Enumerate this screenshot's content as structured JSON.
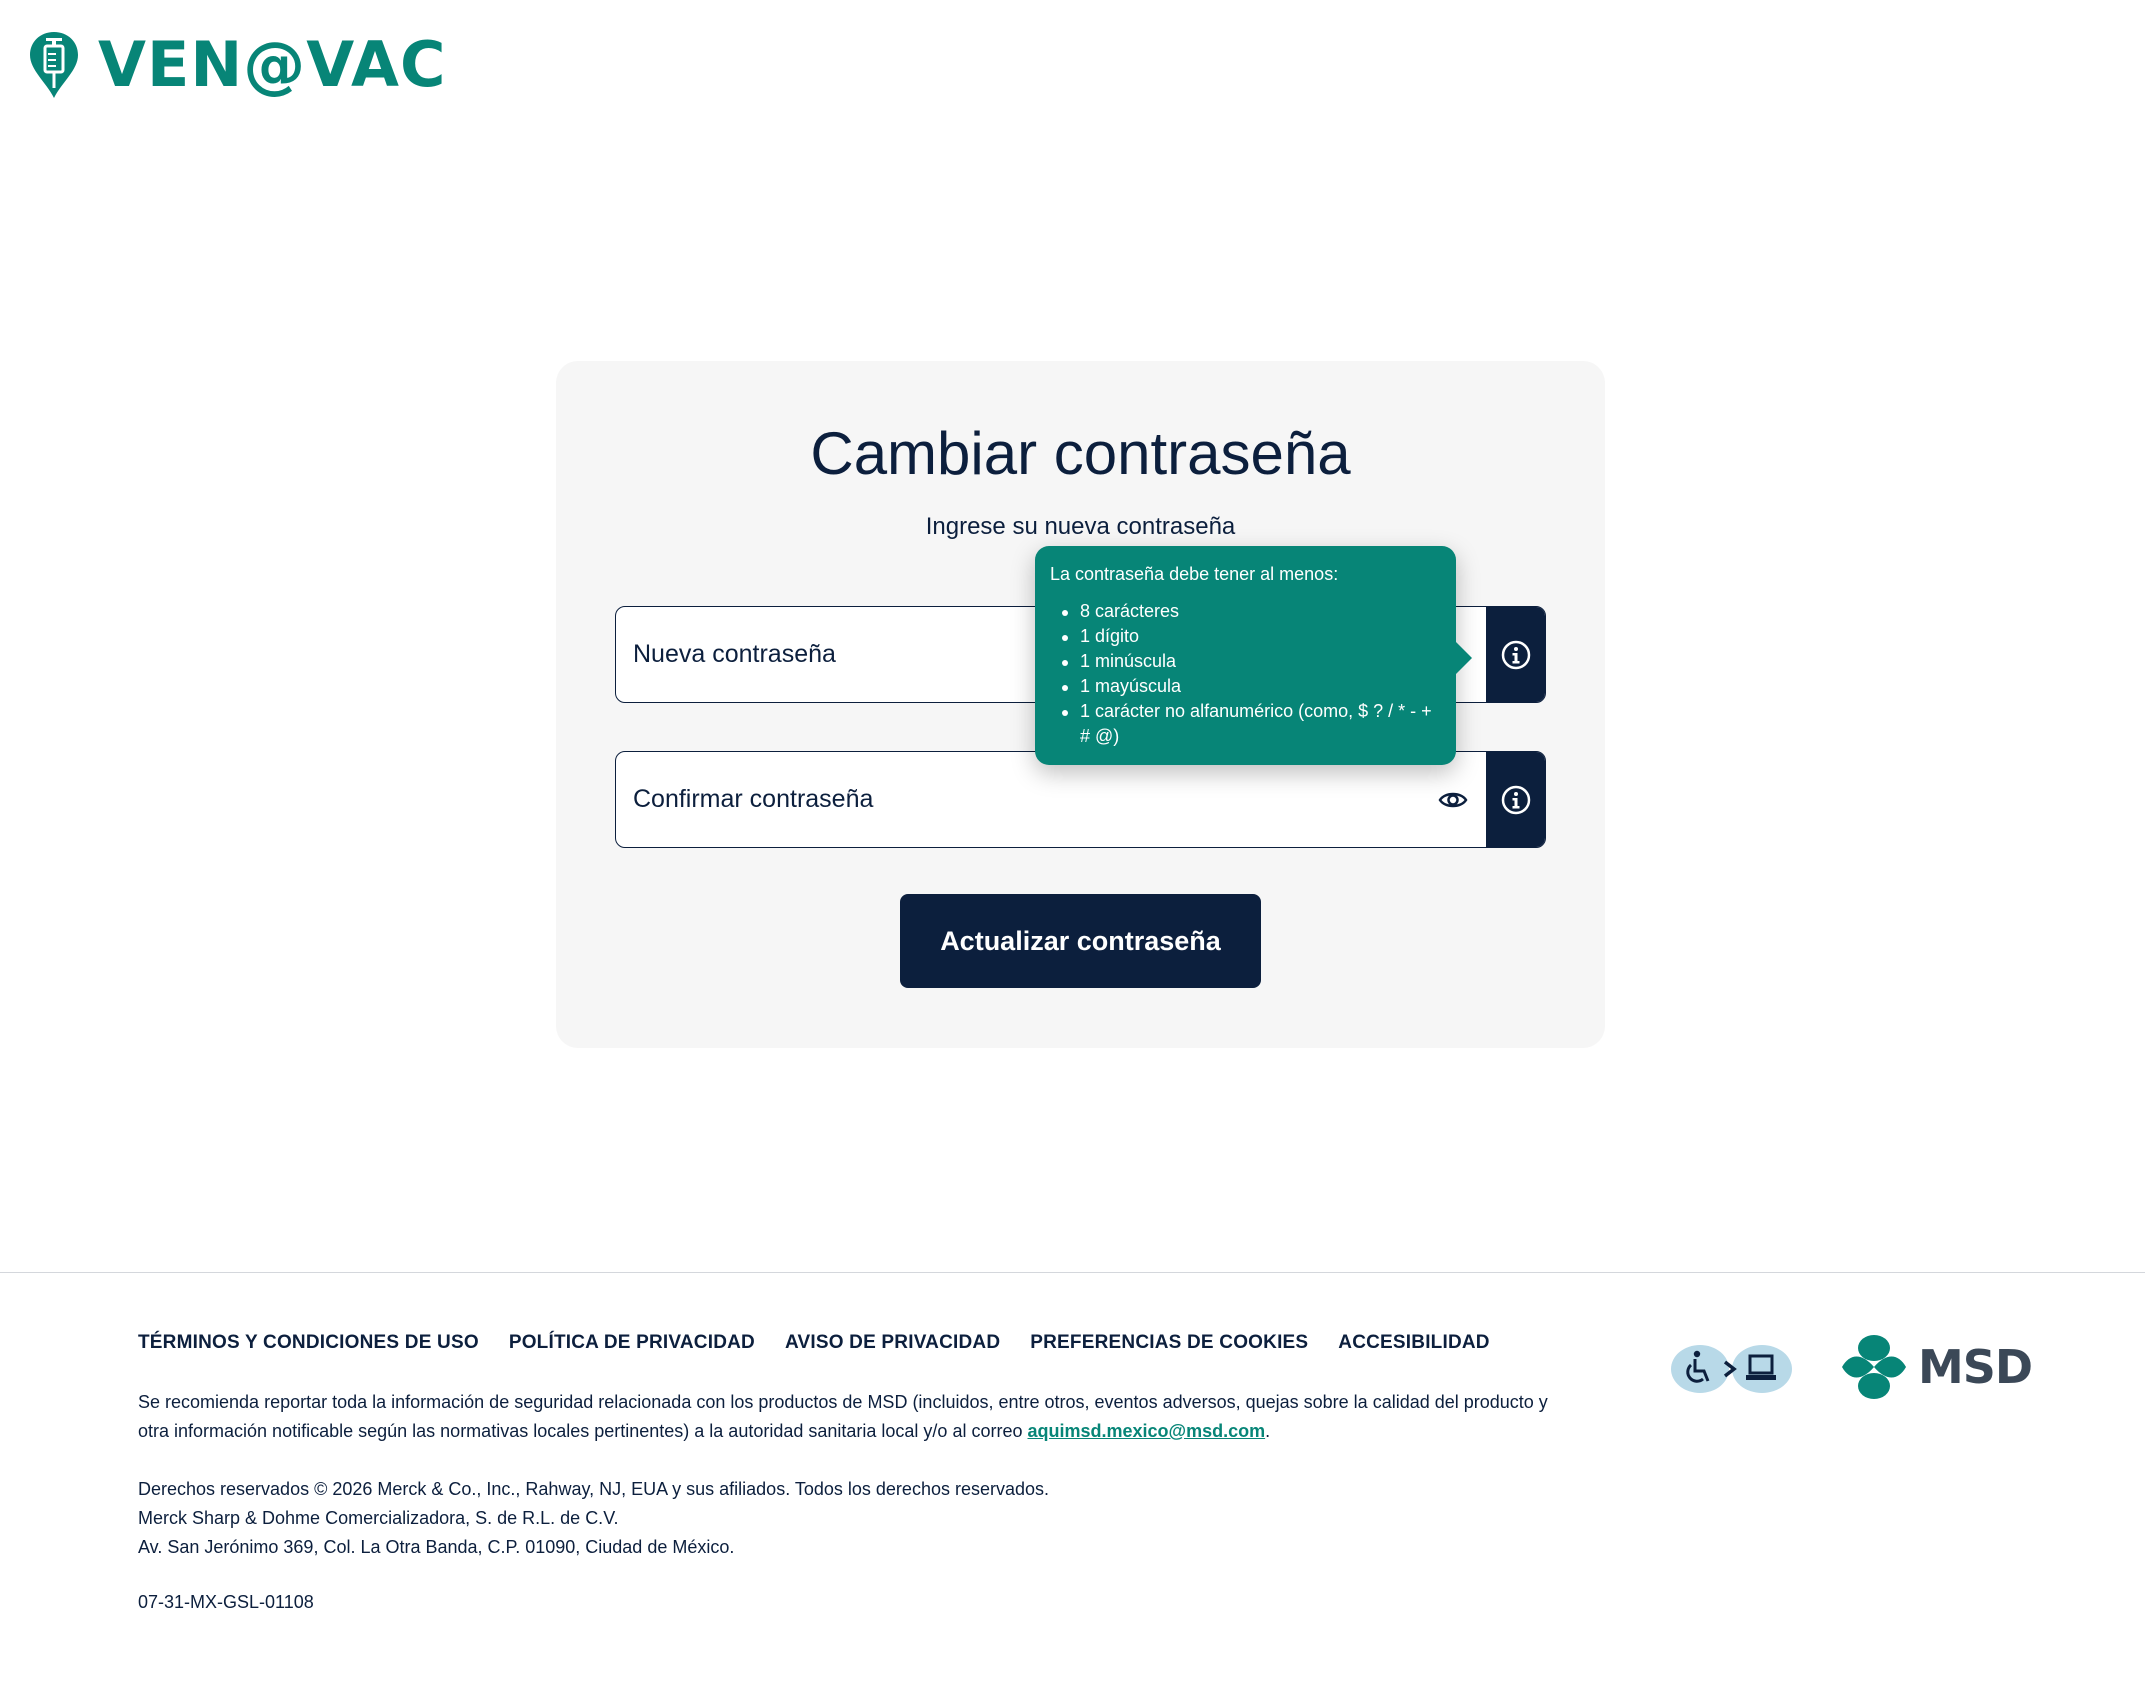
{
  "header": {
    "logo_text": "VEN@VAC"
  },
  "form": {
    "title": "Cambiar contraseña",
    "subtitle": "Ingrese su nueva contraseña",
    "new_password_placeholder": "Nueva contraseña",
    "confirm_password_placeholder": "Confirmar contraseña",
    "submit_label": "Actualizar contraseña"
  },
  "tooltip": {
    "title": "La contraseña debe tener al menos:",
    "requirements": [
      "8 carácteres",
      "1 dígito",
      "1 minúscula",
      "1 mayúscula",
      "1 carácter no alfanumérico (como, $ ? / * - + # @)"
    ]
  },
  "footer": {
    "links": [
      "TÉRMINOS Y CONDICIONES DE USO",
      "POLÍTICA DE PRIVACIDAD",
      "AVISO DE PRIVACIDAD",
      "PREFERENCIAS DE COOKIES",
      "ACCESIBILIDAD"
    ],
    "safety_text": "Se recomienda reportar toda la información de seguridad relacionada con los productos de MSD (incluidos, entre otros, eventos adversos, quejas sobre la calidad del producto y otra información notificable según las normativas locales pertinentes) a la autoridad sanitaria local y/o al correo ",
    "safety_email": "aquimsd.mexico@msd.com",
    "safety_end": ".",
    "rights_lines": [
      "Derechos reservados © 2026 Merck & Co., Inc., Rahway, NJ, EUA y sus afiliados. Todos los derechos reservados.",
      "Merck Sharp & Dohme Comercializadora, S. de R.L. de C.V.",
      "Av. San Jerónimo 369, Col. La Otra Banda, C.P. 01090, Ciudad de México."
    ],
    "code": "07-31-MX-GSL-01108",
    "msd_logo_text": "MSD"
  },
  "colors": {
    "brand_teal": "#078577",
    "navy": "#0c1f3d",
    "card_bg": "#f6f6f6"
  },
  "icons": [
    "syringe-pin-icon",
    "eye-icon",
    "info-icon",
    "accessibility-icon",
    "msd-logo-icon"
  ]
}
